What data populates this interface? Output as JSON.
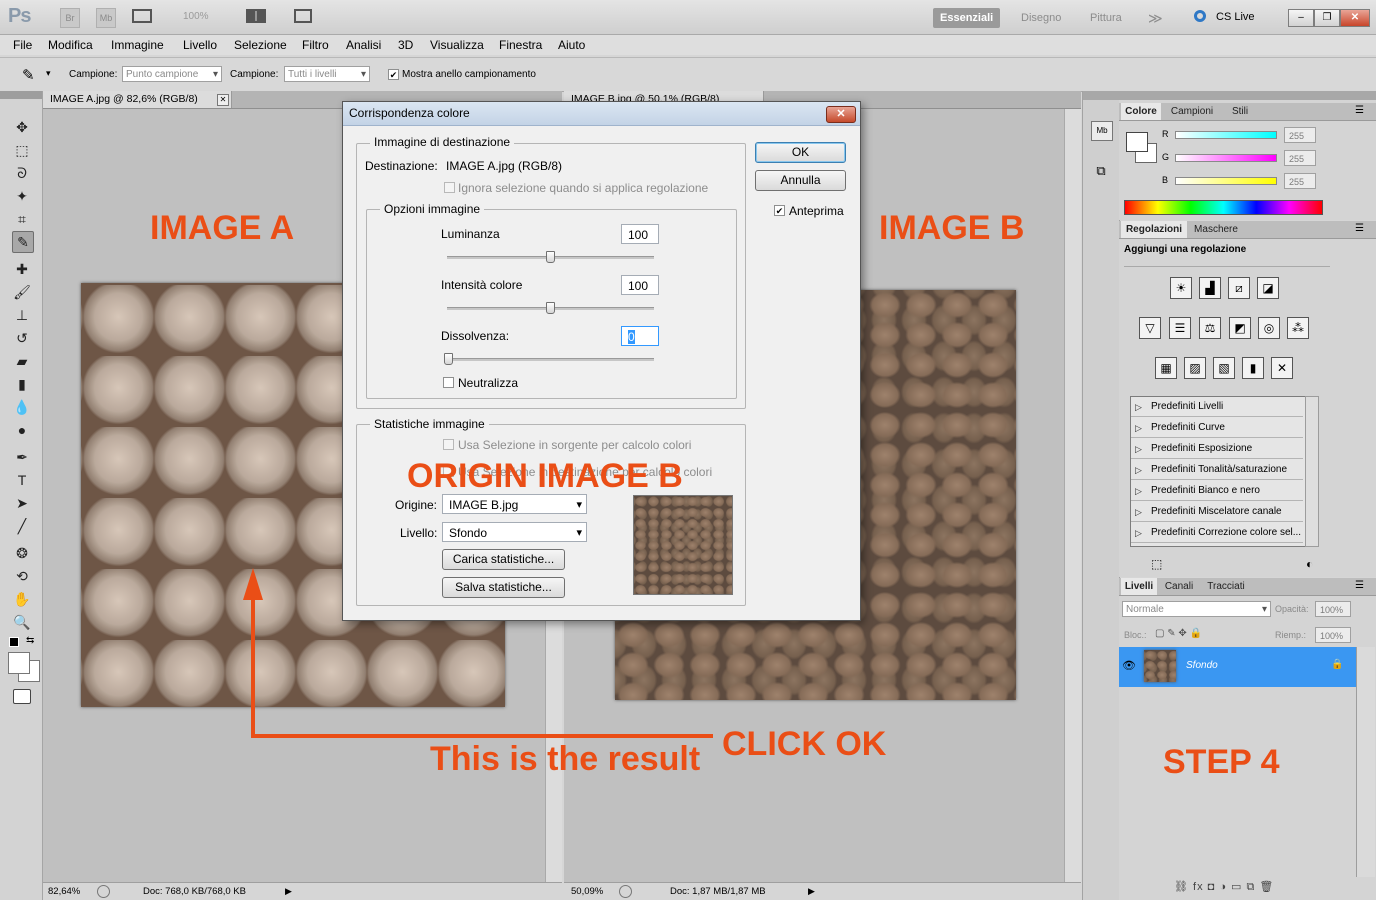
{
  "app": {
    "logo": "Ps",
    "bridge_btn": "Br",
    "minibridge_btn": "Mb",
    "zoom": "100%",
    "workspaces": [
      "Essenziali",
      "Disegno",
      "Pittura"
    ],
    "more": "≫",
    "cslive": "CS Live",
    "win_min": "–",
    "win_max": "❐",
    "win_close": "✕"
  },
  "menu": [
    "File",
    "Modifica",
    "Immagine",
    "Livello",
    "Selezione",
    "Filtro",
    "Analisi",
    "3D",
    "Visualizza",
    "Finestra",
    "Aiuto"
  ],
  "options": {
    "label1": "Campione:",
    "value1": "Punto campione",
    "label2": "Campione:",
    "value2": "Tutti i livelli",
    "ring_label": "Mostra anello campionamento",
    "ring_check": "✔"
  },
  "doc_a": {
    "tab": "IMAGE A.jpg @ 82,6% (RGB/8)",
    "tab_close": "✕",
    "zoom": "82,64%",
    "status": "Doc: 768,0 KB/768,0 KB"
  },
  "doc_b": {
    "tab": "IMAGE B.jpg @ 50,1% (RGB/8)",
    "zoom": "50,09%",
    "status": "Doc: 1,87 MB/1,87 MB"
  },
  "overlay": {
    "image_a": "IMAGE A",
    "image_b": "IMAGE B",
    "origin": "ORIGIN IMAGE B",
    "click_ok": "CLICK OK",
    "result": "This is the result",
    "step": "STEP 4"
  },
  "colore_panel": {
    "tabs": [
      "Colore",
      "Campioni",
      "Stili"
    ],
    "channels": [
      {
        "label": "R",
        "value": "255",
        "color": "#00ffff"
      },
      {
        "label": "G",
        "value": "255",
        "color": "#ff00ff"
      },
      {
        "label": "B",
        "value": "255",
        "color": "#ffff00"
      }
    ]
  },
  "regolazioni_panel": {
    "tabs": [
      "Regolazioni",
      "Maschere"
    ],
    "header": "Aggiungi una regolazione",
    "icons_row1": [
      "☀",
      "▟",
      "⧄",
      "◪"
    ],
    "icons_row2": [
      "▽",
      "☰",
      "⚖",
      "◩",
      "◎",
      "⁂"
    ],
    "icons_row3": [
      "▦",
      "▨",
      "▧",
      "▮",
      "✕"
    ],
    "presets": [
      "Predefiniti Livelli",
      "Predefiniti Curve",
      "Predefiniti Esposizione",
      "Predefiniti Tonalità/saturazione",
      "Predefiniti Bianco e nero",
      "Predefiniti Miscelatore canale",
      "Predefiniti Correzione colore sel..."
    ]
  },
  "livelli_panel": {
    "tabs": [
      "Livelli",
      "Canali",
      "Tracciati"
    ],
    "blend": "Normale",
    "opacity_label": "Opacità:",
    "opacity": "100%",
    "lock_label": "Bloc.:",
    "fill_label": "Riemp.:",
    "fill": "100%",
    "layer_name": "Sfondo",
    "footer_icons": "⛓  fx  ◘  ◑  ▭  ⧉  🗑"
  },
  "dialog": {
    "title": "Corrispondenza colore",
    "close": "✕",
    "dest_group": "Immagine di destinazione",
    "dest_label": "Destinazione:",
    "dest_value": "IMAGE A.jpg (RGB/8)",
    "ignore_sel": "Ignora selezione quando si applica regolazione",
    "opts_group": "Opzioni immagine",
    "luminanza_label": "Luminanza",
    "luminanza": "100",
    "intensita_label": "Intensità colore",
    "intensita": "100",
    "dissolvenza_label": "Dissolvenza:",
    "dissolvenza": "0",
    "neutralizza": "Neutralizza",
    "stats_group": "Statistiche immagine",
    "use_sel_src": "Usa Selezione in sorgente per calcolo colori",
    "use_sel_dst": "Usa Selezione in destinazione per calcolo colori",
    "origine_label": "Origine:",
    "origine_value": "IMAGE B.jpg",
    "livello_label": "Livello:",
    "livello_value": "Sfondo",
    "load_btn": "Carica statistiche...",
    "save_btn": "Salva statistiche...",
    "ok": "OK",
    "cancel": "Annulla",
    "preview": "Anteprima",
    "preview_check": "✔"
  }
}
